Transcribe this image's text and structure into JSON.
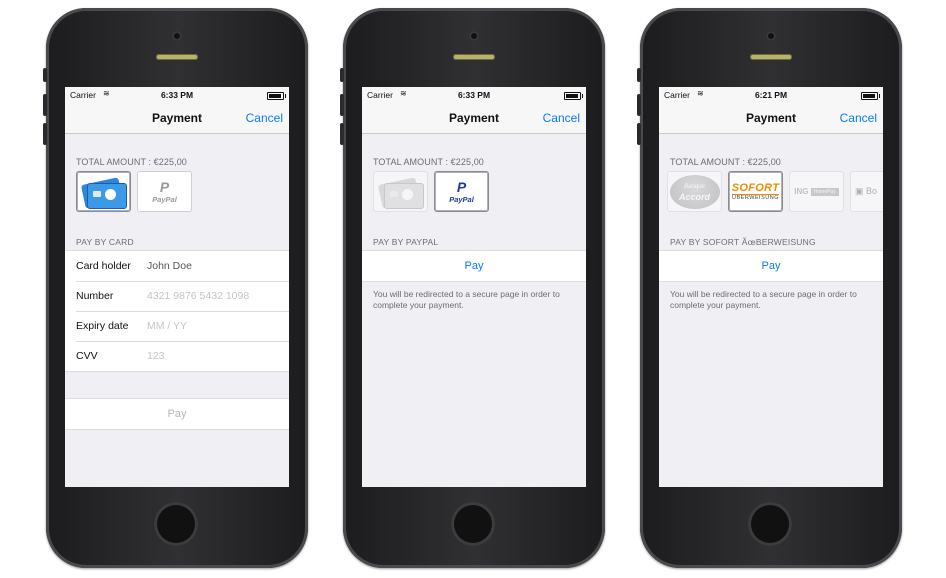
{
  "status": {
    "carrier": "Carrier",
    "wifi_icon": "wifi-icon",
    "battery_icon": "battery-icon"
  },
  "phones": [
    {
      "time": "6:33 PM",
      "title": "Payment",
      "cancel": "Cancel",
      "amount": "TOTAL AMOUNT : €225,00",
      "methods": [
        "Credit card",
        "PayPal"
      ],
      "selected_method": "Credit card",
      "section": "PAY BY CARD",
      "fields": [
        {
          "label": "Card holder",
          "value": "John Doe",
          "placeholder": ""
        },
        {
          "label": "Number",
          "value": "",
          "placeholder": "4321 9876 5432 1098"
        },
        {
          "label": "Expiry date",
          "value": "",
          "placeholder": "MM / YY"
        },
        {
          "label": "CVV",
          "value": "",
          "placeholder": "123"
        }
      ],
      "pay": "Pay",
      "pay_enabled": false
    },
    {
      "time": "6:33 PM",
      "title": "Payment",
      "cancel": "Cancel",
      "amount": "TOTAL AMOUNT : €225,00",
      "methods": [
        "Credit card",
        "PayPal"
      ],
      "selected_method": "PayPal",
      "section": "PAY BY PAYPAL",
      "pay": "Pay",
      "pay_enabled": true,
      "note": "You will be redirected to a secure page in order to complete your payment."
    },
    {
      "time": "6:21 PM",
      "title": "Payment",
      "cancel": "Cancel",
      "amount": "TOTAL AMOUNT : €225,00",
      "methods": [
        "Banque Accord",
        "Sofort Überweisung",
        "ING",
        "Bo"
      ],
      "selected_method": "Sofort Überweisung",
      "section": "PAY BY SOFORT ÃœBERWEISUNG",
      "pay": "Pay",
      "pay_enabled": true,
      "note": "You will be redirected to a secure page in order to complete your payment."
    }
  ],
  "logos": {
    "paypal_mark": "P",
    "paypal_word": "PayPal",
    "banque_top": "Banque",
    "banque_word": "Accord",
    "sofort_word": "SOFORT",
    "sofort_sub": "ÜBERWEISUNG",
    "ing_word": "ING",
    "ing_box": "HomePay",
    "last_word": "Bo"
  },
  "colors": {
    "accent": "#0a7cf4",
    "background": "#efeff4",
    "sofort": "#f28c00",
    "paypal": "#1f3f93"
  }
}
